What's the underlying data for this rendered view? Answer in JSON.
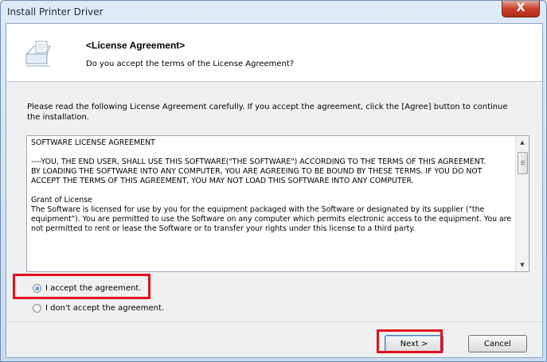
{
  "window": {
    "title": "Install Printer Driver",
    "close_glyph": "X"
  },
  "header": {
    "title": "<License Agreement>",
    "subtitle": "Do you accept the terms of the License Agreement?",
    "icon": "setup-wizard-icon"
  },
  "intro_text": "Please read the following License Agreement carefully. If you accept the agreement, click the [Agree] button to continue the installation.",
  "license_text": "SOFTWARE LICENSE AGREEMENT\n\n----YOU, THE END USER, SHALL USE THIS SOFTWARE(\"THE SOFTWARE\") ACCORDING TO THE TERMS OF THIS AGREEMENT.\nBY LOADING THE SOFTWARE INTO ANY COMPUTER, YOU ARE AGREEING TO BE BOUND BY THESE TERMS. IF YOU DO NOT ACCEPT THE TERMS OF THIS AGREEMENT, YOU MAY NOT LOAD THIS SOFTWARE INTO ANY COMPUTER.\n\nGrant of License\nThe Software is licensed for use by you for the equipment packaged with the Software or designated by its supplier (\"the equipment\"). You are permitted to use the Software on any computer which permits electronic access to the equipment. You are not permitted to rent or lease the Software or to transfer your rights under this license to a third party.",
  "options": {
    "accept_label": "I accept the agreement.",
    "decline_label": "I don't accept the agreement.",
    "selected": "accept"
  },
  "buttons": {
    "next_label": "Next >",
    "cancel_label": "Cancel"
  },
  "colors": {
    "highlight": "#e0101c",
    "close_button": "#c8412a"
  }
}
